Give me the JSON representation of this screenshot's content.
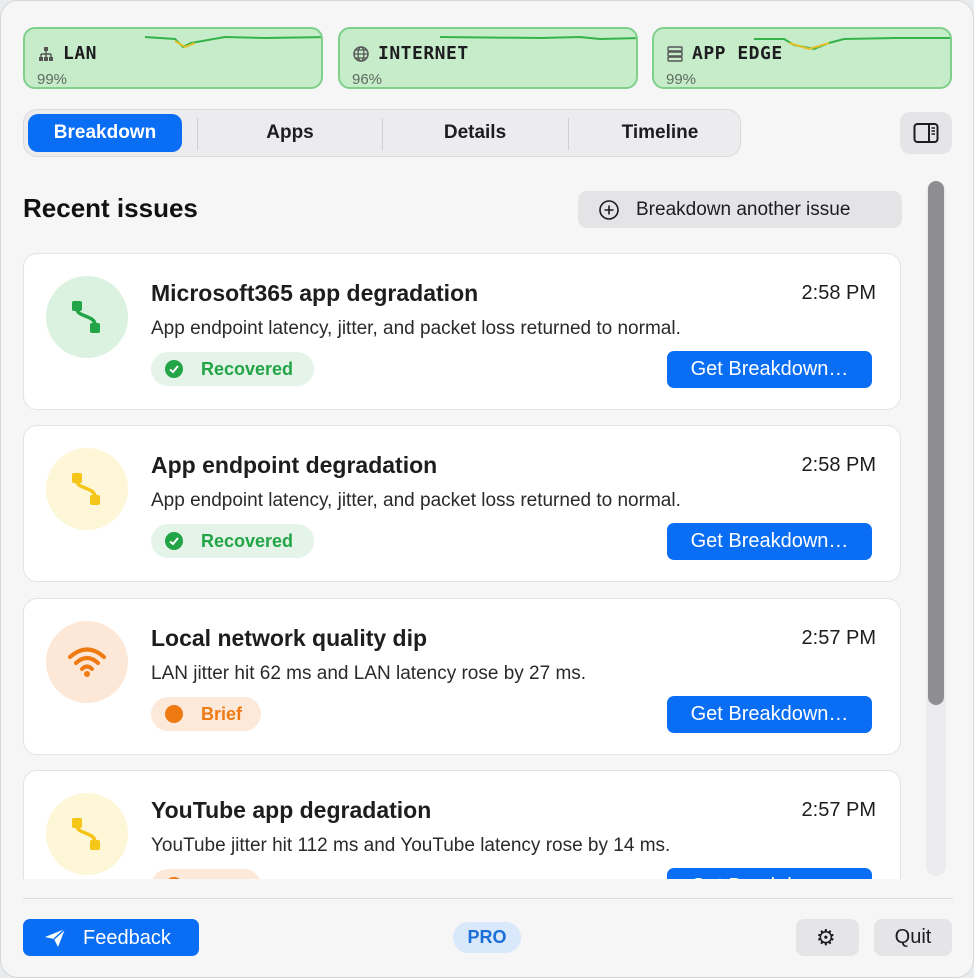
{
  "status_cards": [
    {
      "name": "LAN",
      "percent": "99%",
      "icon": "network-tree-icon"
    },
    {
      "name": "INTERNET",
      "percent": "96%",
      "icon": "globe-icon"
    },
    {
      "name": "APP EDGE",
      "percent": "99%",
      "icon": "server-icon"
    }
  ],
  "tabs": [
    {
      "label": "Breakdown",
      "active": true
    },
    {
      "label": "Apps",
      "active": false
    },
    {
      "label": "Details",
      "active": false
    },
    {
      "label": "Timeline",
      "active": false
    }
  ],
  "header": {
    "title": "Recent issues",
    "another_label": "Breakdown another issue"
  },
  "issues": [
    {
      "title": "Microsoft365 app degradation",
      "time": "2:58 PM",
      "description": "App endpoint latency, jitter, and packet loss returned to normal.",
      "badge": "Recovered",
      "action": "Get Breakdown…",
      "icon": "route-icon"
    },
    {
      "title": "App endpoint degradation",
      "time": "2:58 PM",
      "description": "App endpoint latency, jitter, and packet loss returned to normal.",
      "badge": "Recovered",
      "action": "Get Breakdown…",
      "icon": "route-icon"
    },
    {
      "title": "Local network quality dip",
      "time": "2:57 PM",
      "description": "LAN jitter hit 62 ms and LAN latency rose by 27 ms.",
      "badge": "Brief",
      "action": "Get Breakdown…",
      "icon": "wifi-icon"
    },
    {
      "title": "YouTube app degradation",
      "time": "2:57 PM",
      "description": "YouTube jitter hit 112 ms and YouTube latency rose by 14 ms.",
      "badge": "",
      "action": "Get Breakdown…",
      "icon": "route-icon"
    }
  ],
  "footer": {
    "feedback_label": "Feedback",
    "pro_label": "PRO",
    "quit_label": "Quit"
  },
  "colors": {
    "accent": "#0a6ef5",
    "status_good_bg": "#c6ecca",
    "status_good_border": "#7ed08a",
    "recovered": "#22a447",
    "brief": "#f07a12",
    "warning_yellow": "#f5c518"
  }
}
